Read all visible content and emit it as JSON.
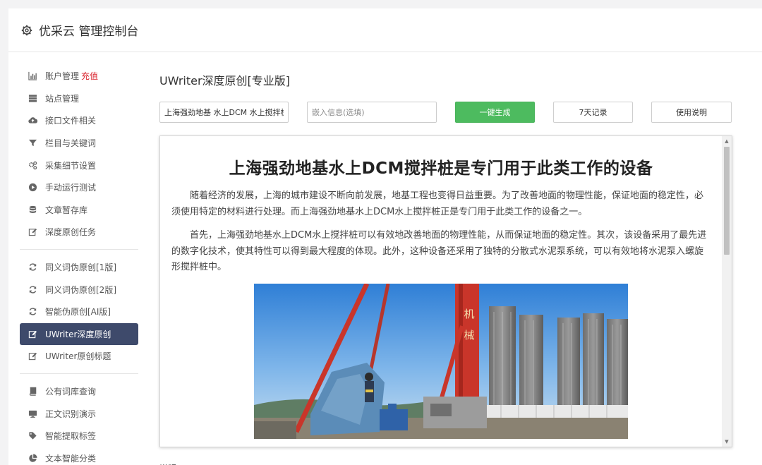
{
  "header": {
    "title": "优采云 管理控制台",
    "icon": "gear-icon"
  },
  "sidebar": {
    "group1": [
      {
        "label": "账户管理",
        "badge": "充值",
        "icon": "bar-chart-icon"
      },
      {
        "label": "站点管理",
        "icon": "server-icon"
      },
      {
        "label": "接口文件相关",
        "icon": "cloud-upload-icon"
      },
      {
        "label": "栏目与关键词",
        "icon": "filter-icon"
      },
      {
        "label": "采集细节设置",
        "icon": "gears-icon"
      },
      {
        "label": "手动运行测试",
        "icon": "play-circle-icon"
      },
      {
        "label": "文章暂存库",
        "icon": "database-icon"
      },
      {
        "label": "深度原创任务",
        "icon": "edit-icon"
      }
    ],
    "group2": [
      {
        "label": "同义词伪原创[1版]",
        "icon": "refresh-icon"
      },
      {
        "label": "同义词伪原创[2版]",
        "icon": "refresh-icon"
      },
      {
        "label": "智能伪原创[AI版]",
        "icon": "refresh-icon"
      },
      {
        "label": "UWriter深度原创",
        "icon": "edit-icon",
        "active": true
      },
      {
        "label": "UWriter原创标题",
        "icon": "edit-icon"
      }
    ],
    "group3": [
      {
        "label": "公有词库查询",
        "icon": "book-icon"
      },
      {
        "label": "正文识别演示",
        "icon": "monitor-icon"
      },
      {
        "label": "智能提取标签",
        "icon": "tag-icon"
      },
      {
        "label": "文本智能分类",
        "icon": "pie-chart-icon"
      }
    ]
  },
  "main": {
    "title": "UWriter深度原创[专业版]",
    "keyword_input": {
      "value": "上海强劲地基 水上DCM 水上搅拌桩"
    },
    "embed_input": {
      "placeholder": "嵌入信息(选填)"
    },
    "buttons": {
      "generate": "一键生成",
      "history": "7天记录",
      "help": "使用说明"
    },
    "article": {
      "title": "上海强劲地基水上DCM搅拌桩是专门用于此类工作的设备",
      "paragraphs": [
        "随着经济的发展，上海的城市建设不断向前发展，地基工程也变得日益重要。为了改善地面的物理性能，保证地面的稳定性，必须使用特定的材料进行处理。而上海强劲地基水上DCM水上搅拌桩正是专门用于此类工作的设备之一。",
        "首先，上海强劲地基水上DCM水上搅拌桩可以有效地改善地面的物理性能，从而保证地面的稳定性。其次，该设备采用了最先进的数字化技术，使其特性可以得到最大程度的体现。此外，这种设备还采用了独特的分散式水泥泵系统，可以有效地将水泥泵入螺旋形搅拌桩中。"
      ],
      "image_rig_text": "机械"
    },
    "footer_label": "说明"
  }
}
